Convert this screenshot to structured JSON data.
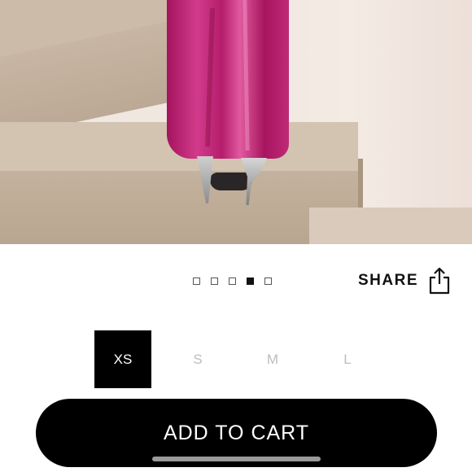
{
  "product_image": {
    "alt": ""
  },
  "gallery": {
    "count": 5,
    "active_index": 3
  },
  "share": {
    "label": "SHARE",
    "icon": "share-icon"
  },
  "sizes": {
    "options": [
      "XS",
      "S",
      "M",
      "L"
    ],
    "selected": "XS"
  },
  "cart": {
    "label": "ADD TO CART"
  },
  "colors": {
    "accent": "#000000",
    "dress": "#c02a78"
  }
}
